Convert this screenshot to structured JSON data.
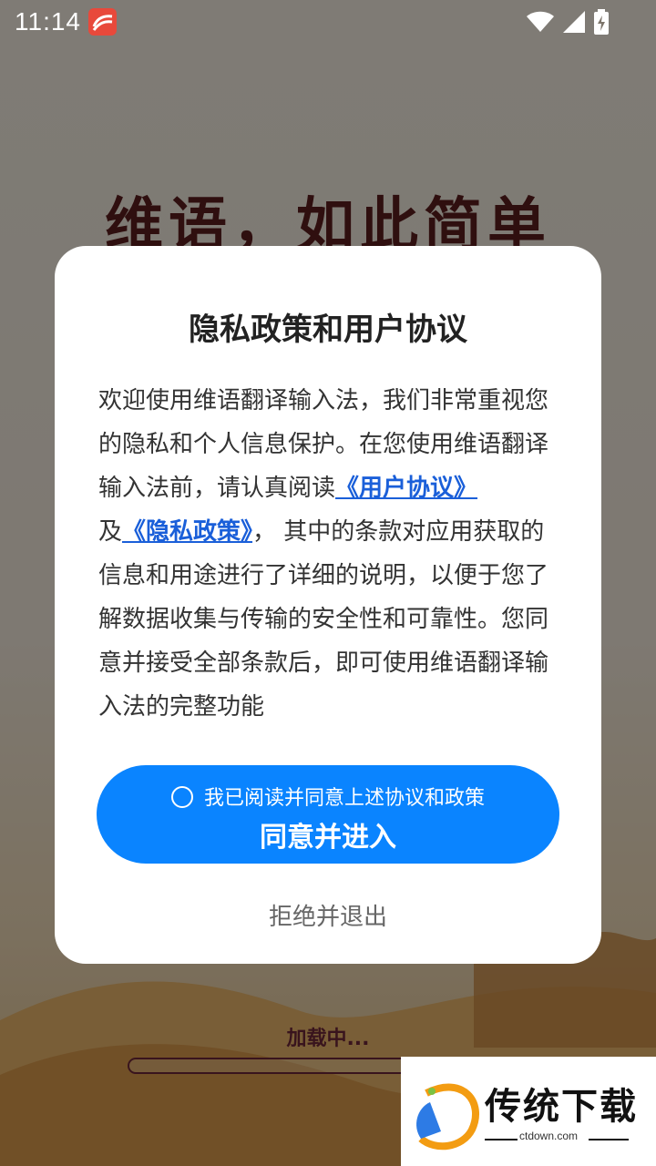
{
  "status_bar": {
    "time": "11:14",
    "icons": [
      "app-notification-icon",
      "wifi-icon",
      "signal-icon",
      "battery-charging-icon"
    ]
  },
  "background": {
    "slogan": "维语，如此简单",
    "loading_text": "加载中..."
  },
  "dialog": {
    "title": "隐私政策和用户协议",
    "body_before": "欢迎使用维语翻译输入法，我们非常重视您的隐私和个人信息保护。在您使用维语翻译输入法前，请认真阅读",
    "link_user_agreement": "《用户协议》",
    "body_and": "及",
    "link_privacy_policy": "《隐私政策》",
    "body_after": "， 其中的条款对应用获取的信息和用途进行了详细的说明，以便于您了解数据收集与传输的安全性和可靠性。您同意并接受全部条款后，即可使用维语翻译输入法的完整功能",
    "checkbox_label": "我已阅读并同意上述协议和政策",
    "agree_button": "同意并进入",
    "reject_button": "拒绝并退出"
  },
  "watermark": {
    "brand": "传统下载",
    "url": "ctdown.com"
  },
  "colors": {
    "accent": "#0a84ff",
    "link": "#1a5fd9",
    "slogan": "#5a1d1d"
  }
}
